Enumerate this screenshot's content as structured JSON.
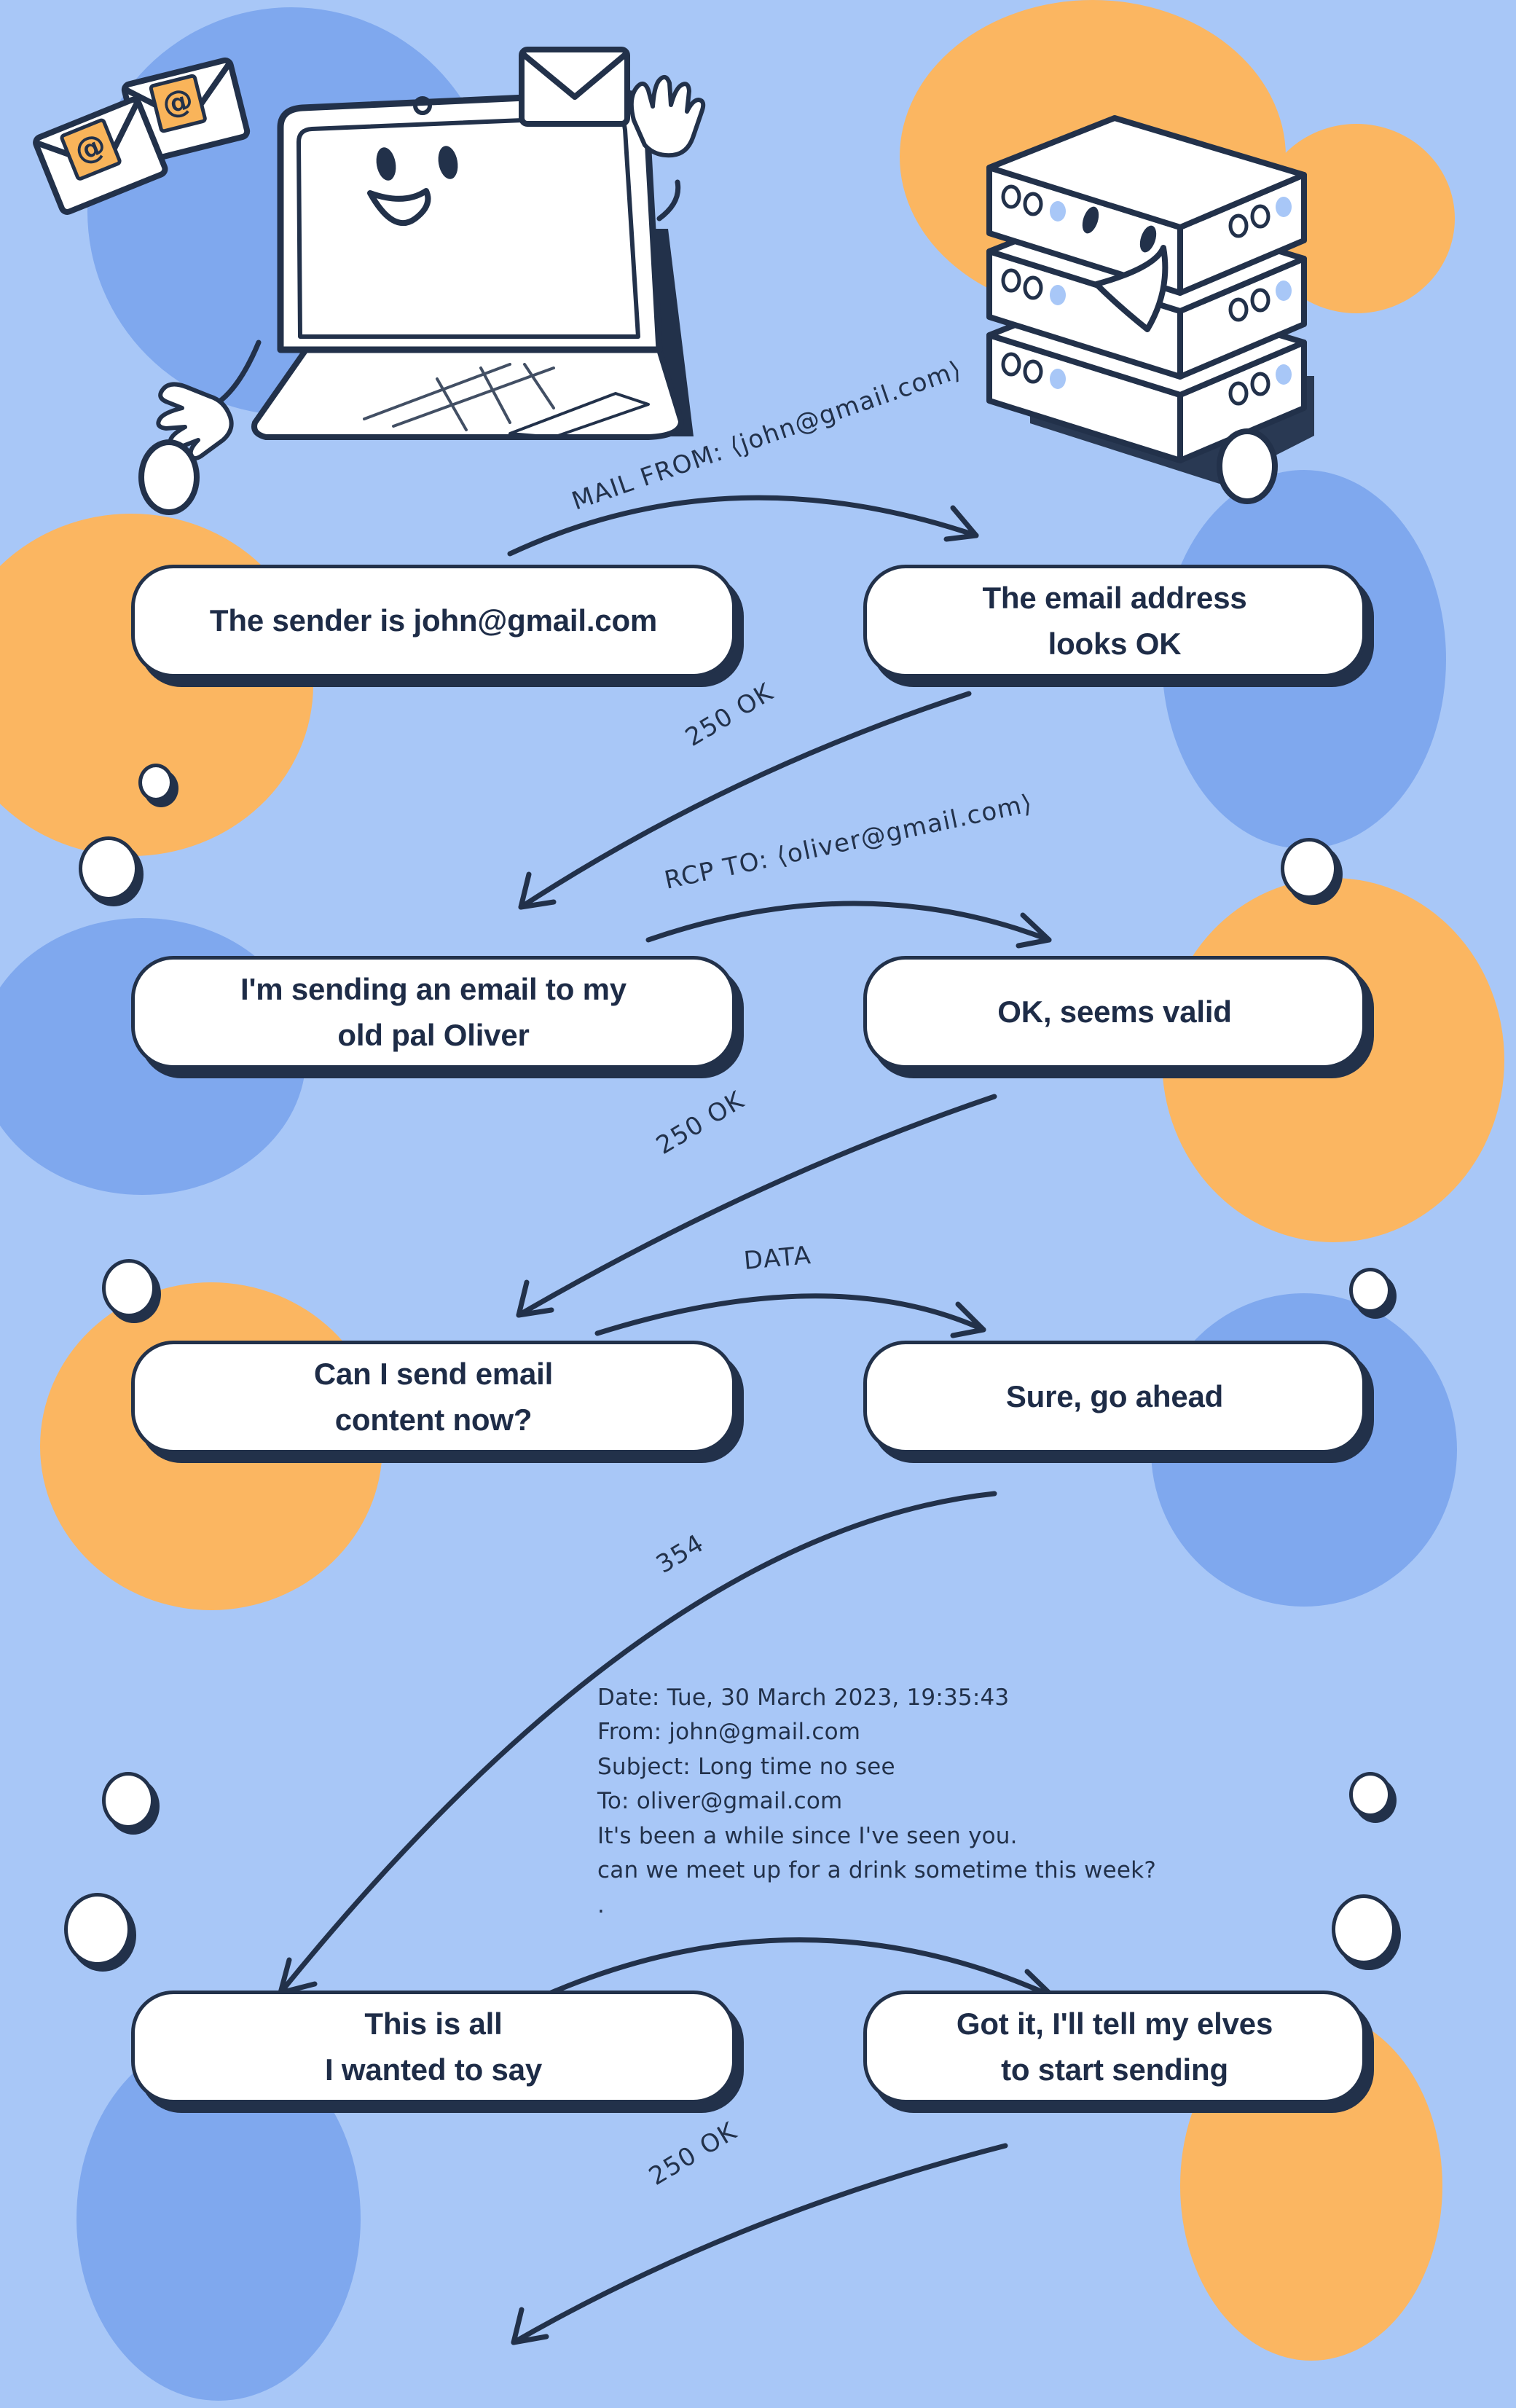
{
  "meta": {
    "title": "SMTP email conversation diagram",
    "background_color": "#a8c7f7",
    "blob_blue": "#7fa8ee",
    "blob_orange": "#f9b košt"
  },
  "colors": {
    "background": "#a8c7f7",
    "blob_blue": "#7fa8ee",
    "blob_orange": "#fbb661",
    "ink": "#22314a",
    "bubble_fill": "#ffffff",
    "stamp_orange": "#f9b45a",
    "led_blue": "#a8c7f7"
  },
  "illustrations": {
    "client": {
      "name": "laptop-character",
      "envelopes": 3,
      "stamp_glyph": "@"
    },
    "server": {
      "name": "server-stack-character",
      "units": 3
    }
  },
  "arrows": [
    {
      "id": "mail-from",
      "label": "MAIL FROM: ⟨john@gmail.com⟩",
      "direction": "right"
    },
    {
      "id": "ok-250-1",
      "label": "250 OK",
      "direction": "left"
    },
    {
      "id": "rcp-to",
      "label": "RCP TO: ⟨oliver@gmail.com⟩",
      "direction": "right"
    },
    {
      "id": "ok-250-2",
      "label": "250 OK",
      "direction": "left"
    },
    {
      "id": "data",
      "label": "DATA",
      "direction": "right"
    },
    {
      "id": "code-354",
      "label": "354",
      "direction": "left"
    },
    {
      "id": "send-data",
      "label": "",
      "direction": "right"
    },
    {
      "id": "ok-250-3",
      "label": "250 OK",
      "direction": "left"
    }
  ],
  "bubbles": [
    {
      "id": "b1",
      "side": "left",
      "lines": [
        "The sender is john@gmail.com"
      ]
    },
    {
      "id": "b2",
      "side": "right",
      "lines": [
        "The email address",
        "looks OK"
      ]
    },
    {
      "id": "b3",
      "side": "left",
      "lines": [
        "I'm sending an email to my",
        "old pal Oliver"
      ]
    },
    {
      "id": "b4",
      "side": "right",
      "lines": [
        "OK, seems valid"
      ]
    },
    {
      "id": "b5",
      "side": "left",
      "lines": [
        "Can I send email",
        "content now?"
      ]
    },
    {
      "id": "b6",
      "side": "right",
      "lines": [
        "Sure, go ahead"
      ]
    },
    {
      "id": "b7",
      "side": "left",
      "lines": [
        "This is all",
        "I wanted to say"
      ]
    },
    {
      "id": "b8",
      "side": "right",
      "lines": [
        "Got it, I'll tell my elves",
        "to start sending"
      ]
    }
  ],
  "email_message": {
    "lines": [
      "Date: Tue, 30 March 2023, 19:35:43",
      "From: john@gmail.com",
      "Subject: Long time no see",
      "To: oliver@gmail.com",
      "It's been a while since I've seen you.",
      "can we meet up for a drink sometime this week?",
      "."
    ]
  }
}
